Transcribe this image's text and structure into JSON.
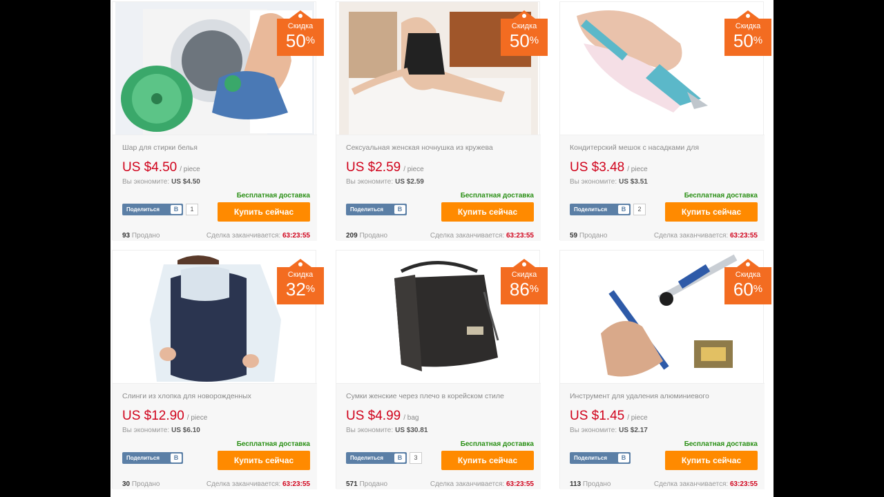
{
  "theme": {
    "accent": "#ff8a00",
    "price_color": "#d0021b",
    "ship_color": "#2a8f15",
    "share_color": "#5b7fa6"
  },
  "products": [
    {
      "image": "washing-ball-photo",
      "discount_label": "Скидка",
      "discount": "50",
      "percent": "%",
      "title": "Шар для стирки белья",
      "price": "US $4.50",
      "unit": "/ piece",
      "save_label": "Вы экономите:",
      "save_value": "US $4.50",
      "shipping": "Бесплатная доставка",
      "share_label": "Поделиться",
      "share_icon_text": "В",
      "share_count": "1",
      "buy_label": "Купить сейчас",
      "sold_count": "93",
      "sold_label": "Продано",
      "deal_label": "Сделка заканчивается:",
      "deal_time": "63:23:55"
    },
    {
      "image": "lingerie-photo",
      "discount_label": "Скидка",
      "discount": "50",
      "percent": "%",
      "title": "Сексуальная женская ночнушка из кружева",
      "price": "US $2.59",
      "unit": "/ piece",
      "save_label": "Вы экономите:",
      "save_value": "US $2.59",
      "shipping": "Бесплатная доставка",
      "share_label": "Поделиться",
      "share_icon_text": "В",
      "share_count": "",
      "buy_label": "Купить сейчас",
      "sold_count": "209",
      "sold_label": "Продано",
      "deal_label": "Сделка заканчивается:",
      "deal_time": "63:23:55"
    },
    {
      "image": "pastry-bag-photo",
      "discount_label": "Скидка",
      "discount": "50",
      "percent": "%",
      "title": "Кондитерский мешок с насадками для",
      "price": "US $3.48",
      "unit": "/ piece",
      "save_label": "Вы экономите:",
      "save_value": "US $3.51",
      "shipping": "Бесплатная доставка",
      "share_label": "Поделиться",
      "share_icon_text": "В",
      "share_count": "2",
      "buy_label": "Купить сейчас",
      "sold_count": "59",
      "sold_label": "Продано",
      "deal_label": "Сделка заканчивается:",
      "deal_time": "63:23:55"
    },
    {
      "image": "baby-carrier-photo",
      "discount_label": "Скидка",
      "discount": "32",
      "percent": "%",
      "title": "Слинги из хлопка для новорожденных",
      "price": "US $12.90",
      "unit": "/ piece",
      "save_label": "Вы экономите:",
      "save_value": "US $6.10",
      "shipping": "Бесплатная доставка",
      "share_label": "Поделиться",
      "share_icon_text": "В",
      "share_count": "",
      "buy_label": "Купить сейчас",
      "sold_count": "30",
      "sold_label": "Продано",
      "deal_label": "Сделка заканчивается:",
      "deal_time": "63:23:55"
    },
    {
      "image": "shoulder-bag-photo",
      "discount_label": "Скидка",
      "discount": "86",
      "percent": "%",
      "title": "Сумки женские через плечо в корейском стиле",
      "price": "US $4.99",
      "unit": "/ bag",
      "save_label": "Вы экономите:",
      "save_value": "US $30.81",
      "shipping": "Бесплатная доставка",
      "share_label": "Поделиться",
      "share_icon_text": "В",
      "share_count": "3",
      "buy_label": "Купить сейчас",
      "sold_count": "571",
      "sold_label": "Продано",
      "deal_label": "Сделка заканчивается:",
      "deal_time": "63:23:55"
    },
    {
      "image": "desoldering-pump-photo",
      "discount_label": "Скидка",
      "discount": "60",
      "percent": "%",
      "title": "Инструмент для удаления алюминиевого",
      "price": "US $1.45",
      "unit": "/ piece",
      "save_label": "Вы экономите:",
      "save_value": "US $2.17",
      "shipping": "Бесплатная доставка",
      "share_label": "Поделиться",
      "share_icon_text": "В",
      "share_count": "",
      "buy_label": "Купить сейчас",
      "sold_count": "113",
      "sold_label": "Продано",
      "deal_label": "Сделка заканчивается:",
      "deal_time": "63:23:55"
    }
  ]
}
